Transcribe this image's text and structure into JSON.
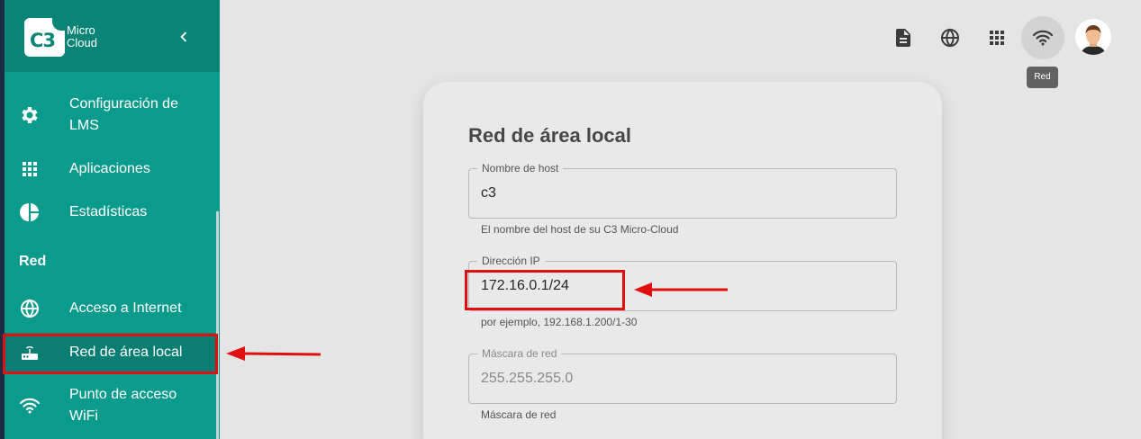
{
  "brand": {
    "logo_mark": "C3",
    "line1": "Micro",
    "line2": "Cloud"
  },
  "sidebar": {
    "items": [
      {
        "label_line1": "Configuración de",
        "label_line2": "LMS",
        "icon": "gear-icon"
      },
      {
        "label": "Aplicaciones",
        "icon": "apps-grid-icon"
      },
      {
        "label": "Estadísticas",
        "icon": "pie-chart-icon"
      }
    ],
    "section": "Red",
    "section_items": [
      {
        "label": "Acceso a Internet",
        "icon": "globe-icon"
      },
      {
        "label": "Red de área local",
        "icon": "router-icon",
        "active": true
      },
      {
        "label_line1": "Punto de acceso",
        "label_line2": "WiFi",
        "icon": "wifi-icon"
      }
    ]
  },
  "topbar": {
    "icons": [
      "document-icon",
      "globe-icon",
      "apps-grid-icon",
      "wifi-icon",
      "avatar"
    ],
    "tooltip": "Red"
  },
  "card": {
    "title": "Red de área local",
    "fields": [
      {
        "label": "Nombre de host",
        "value": "c3",
        "hint": "El nombre del host de su C3 Micro-Cloud",
        "disabled": false
      },
      {
        "label": "Dirección IP",
        "value": "172.16.0.1/24",
        "hint": "por ejemplo, 192.168.1.200/1-30",
        "disabled": false
      },
      {
        "label": "Máscara de red",
        "value": "255.255.255.0",
        "hint": "Máscara de red",
        "disabled": true
      }
    ]
  },
  "colors": {
    "sidebar": "#0a9b8c",
    "sidebar_header": "#0a8476",
    "annotation_red": "#e01010",
    "background": "#e5e5e5"
  }
}
